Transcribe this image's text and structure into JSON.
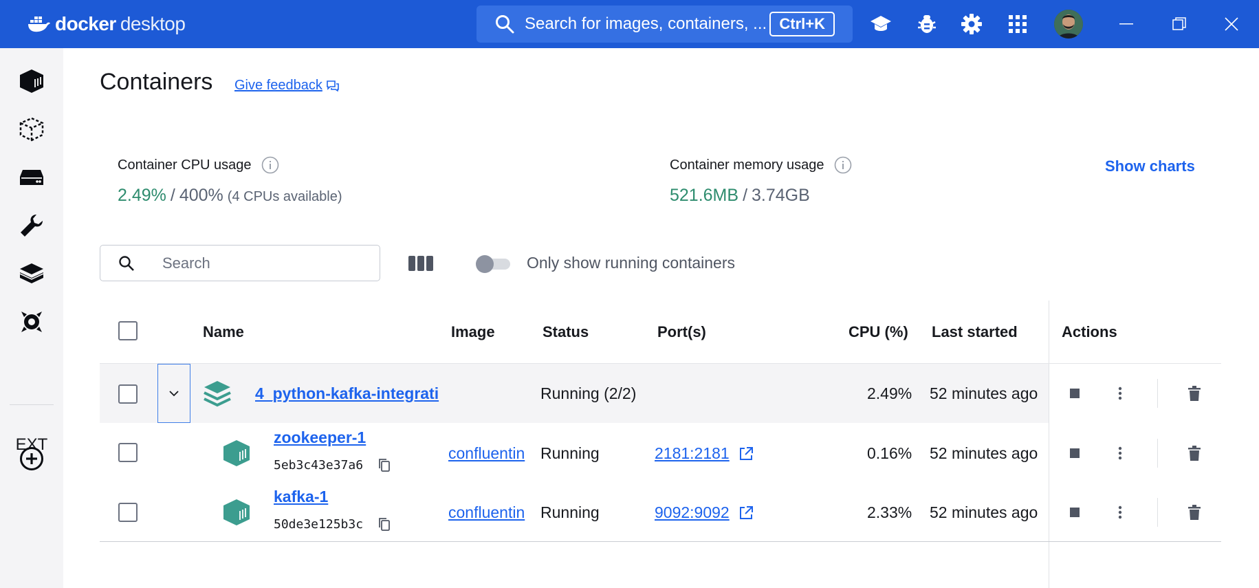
{
  "app": {
    "brand_bold": "docker",
    "brand_light": "desktop",
    "search_placeholder": "Search for images, containers, ...",
    "search_shortcut": "Ctrl+K"
  },
  "sidebar": {
    "items": [
      {
        "icon": "containers-icon"
      },
      {
        "icon": "images-icon"
      },
      {
        "icon": "volumes-icon"
      },
      {
        "icon": "builds-icon"
      },
      {
        "icon": "docker-hub-icon"
      },
      {
        "icon": "docker-scout-icon"
      }
    ],
    "ext_label": "EXT",
    "add_icon": "add-extension-icon"
  },
  "page": {
    "title": "Containers",
    "feedback": "Give feedback"
  },
  "stats": {
    "cpu_label": "Container CPU usage",
    "cpu_used": "2.49%",
    "cpu_total": "400%",
    "cpu_note": "(4 CPUs available)",
    "mem_label": "Container memory usage",
    "mem_used": "521.6MB",
    "mem_total": "3.74GB",
    "show_charts": "Show charts"
  },
  "filters": {
    "search_placeholder": "Search",
    "toggle_label": "Only show running containers",
    "toggle_on": false
  },
  "table": {
    "headers": {
      "name": "Name",
      "image": "Image",
      "status": "Status",
      "ports": "Port(s)",
      "cpu": "CPU (%)",
      "last_started": "Last started",
      "actions": "Actions"
    },
    "group": {
      "name": "4_python-kafka-integrati",
      "status": "Running (2/2)",
      "cpu": "2.49%",
      "last_started": "52 minutes ago"
    },
    "rows": [
      {
        "name": "zookeeper-1",
        "id": "5eb3c43e37a6",
        "image": "confluentin",
        "status": "Running",
        "ports": "2181:2181",
        "cpu": "0.16%",
        "last_started": "52 minutes ago"
      },
      {
        "name": "kafka-1",
        "id": "50de3e125b3c",
        "image": "confluentin",
        "status": "Running",
        "ports": "9092:9092",
        "cpu": "2.33%",
        "last_started": "52 minutes ago"
      }
    ]
  },
  "colors": {
    "titlebar": "#1d5ad6",
    "accent": "#1d63ed",
    "running_green": "#2e8c6e",
    "container_teal": "#3c9d8f"
  }
}
